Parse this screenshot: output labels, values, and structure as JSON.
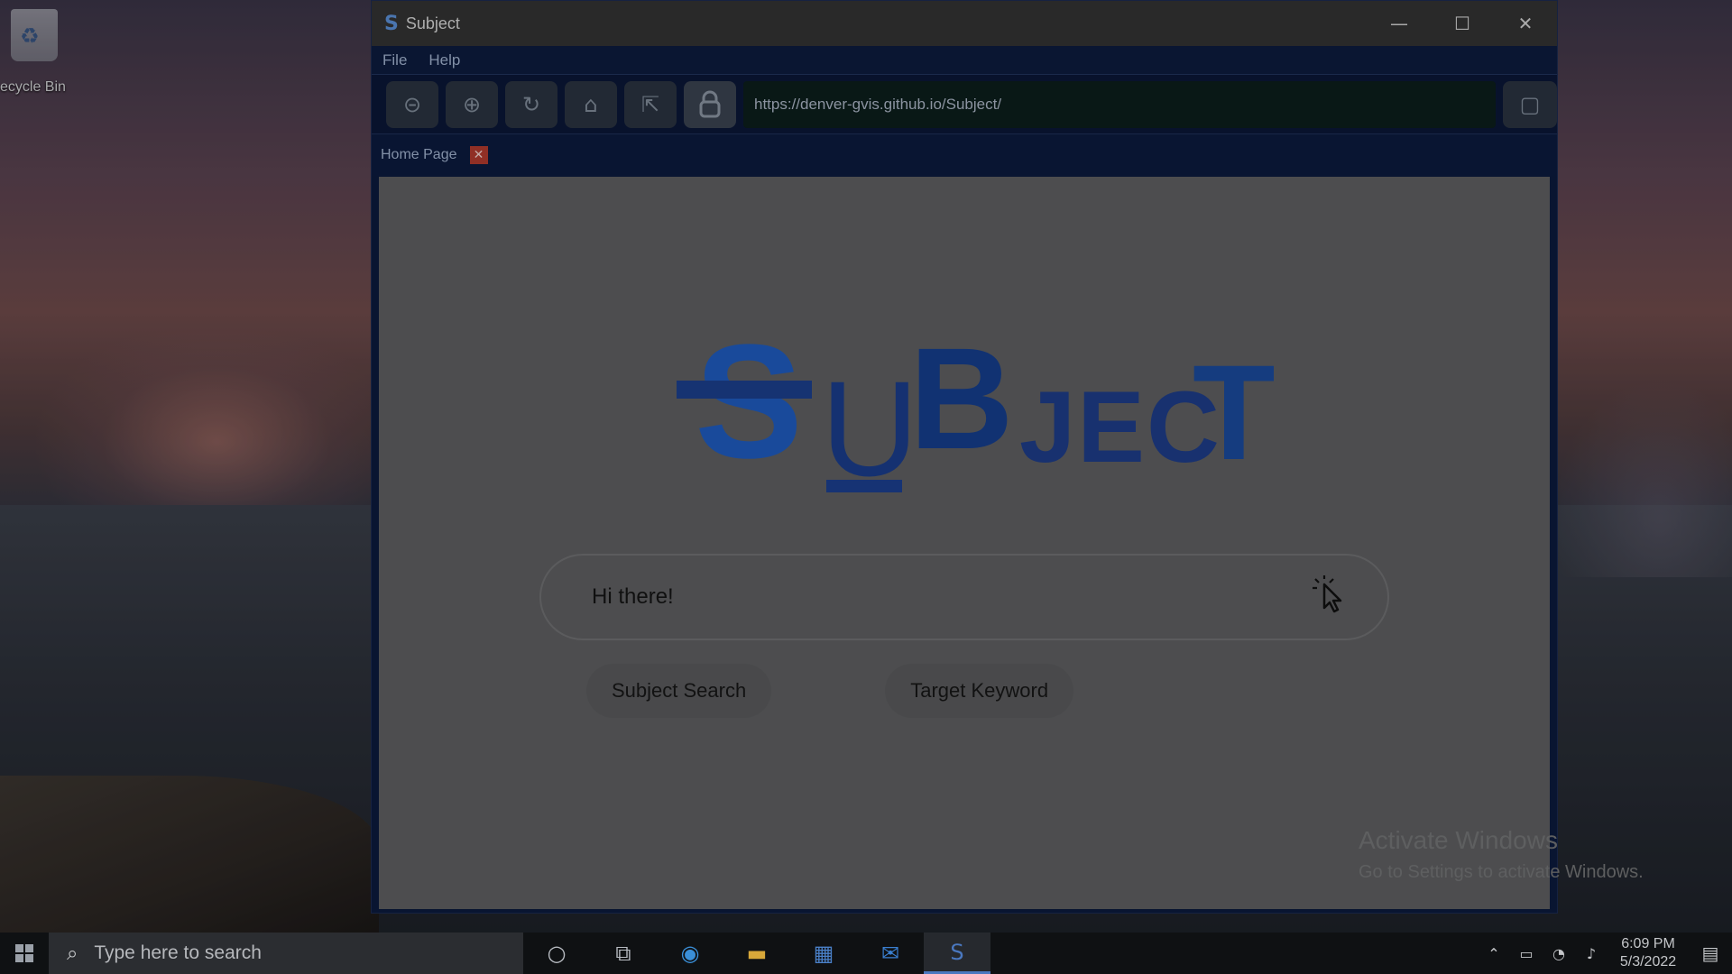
{
  "desktop": {
    "recycle_bin_label": "ecycle Bin"
  },
  "window": {
    "title": "Subject",
    "app_icon": "S",
    "controls": {
      "minimize": "—",
      "maximize": "☐",
      "close": "✕"
    }
  },
  "menu": {
    "items": [
      "File",
      "Help"
    ]
  },
  "toolbar": {
    "back_icon": "⊝",
    "forward_icon": "⊕",
    "reload_icon": "↻",
    "home_icon": "⌂",
    "external_icon": "⇱",
    "lock_icon": "🔒",
    "url": "https://denver-gvis.github.io/Subject/",
    "square_icon": "▢"
  },
  "tabs": {
    "home_label": "Home Page",
    "close_label": "✕"
  },
  "page": {
    "logo": {
      "s": "S",
      "u": "U",
      "b": "B",
      "ject": "JEC",
      "t": "T"
    },
    "search_value": "Hi there!",
    "buttons": [
      "Subject Search",
      "Target Keyword"
    ],
    "watermark_line1": "Activate Windows",
    "watermark_line2": "Go to Settings to activate Windows."
  },
  "taskbar": {
    "search_placeholder": "Type here to search",
    "time": "6:09 PM",
    "date": "5/3/2022"
  },
  "colors": {
    "window_bg": "#0c1a3c",
    "close_tab": "#b03a2e",
    "logo_blue": "#1f5bbd"
  }
}
